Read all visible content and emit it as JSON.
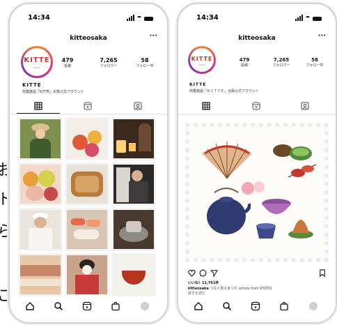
{
  "edge_chars": [
    "お",
    "ト",
    "ら",
    "ご"
  ],
  "status": {
    "time": "14:34"
  },
  "profile": {
    "username": "kitteosaka",
    "more": "···",
    "logo_text": "KITTE",
    "logo_sub": "OSAKA",
    "stats": [
      {
        "value": "479",
        "label": "投稿"
      },
      {
        "value": "7,265",
        "label": "フォロワー"
      },
      {
        "value": "58",
        "label": "フォロー中"
      }
    ],
    "bio_name": "KITTE",
    "bio_desc_left": "商業施設「KITTE」大阪公式アカウント",
    "bio_desc_right": "商業施設「ＫＩＴＴＥ」大阪公式アカウント"
  },
  "tabs": [
    {
      "icon": "grid-icon"
    },
    {
      "icon": "reels-icon"
    },
    {
      "icon": "tagged-icon"
    }
  ],
  "grid_photos": [
    {
      "name": "woman-with-hat",
      "bg": "#7f8f4e"
    },
    {
      "name": "temari-balls",
      "bg": "#f2ede6"
    },
    {
      "name": "lantern-night",
      "bg": "#3a2a1e"
    },
    {
      "name": "fruits",
      "bg": "#f1d8c8"
    },
    {
      "name": "bento-box",
      "bg": "#b9793d"
    },
    {
      "name": "chef-cutting",
      "bg": "#2c2a28"
    },
    {
      "name": "craftsman",
      "bg": "#e9e4dc"
    },
    {
      "name": "sushi",
      "bg": "#d7c6b3"
    },
    {
      "name": "pottery-wheel",
      "bg": "#4a3a2e"
    },
    {
      "name": "kimono-fabric",
      "bg": "#e8c7a8"
    },
    {
      "name": "maiko",
      "bg": "#c9a48a"
    },
    {
      "name": "lacquer-bowl",
      "bg": "#f5f1ec"
    }
  ],
  "post": {
    "likes": "いいね！11,761件",
    "caption_user": "kitteosaka",
    "caption_text": "つなぐ見えまつり   artists from KYOTO",
    "caption_more": "続きを読む"
  },
  "colors": {
    "accent": "#c0392b",
    "border": "#d3d3d3"
  }
}
